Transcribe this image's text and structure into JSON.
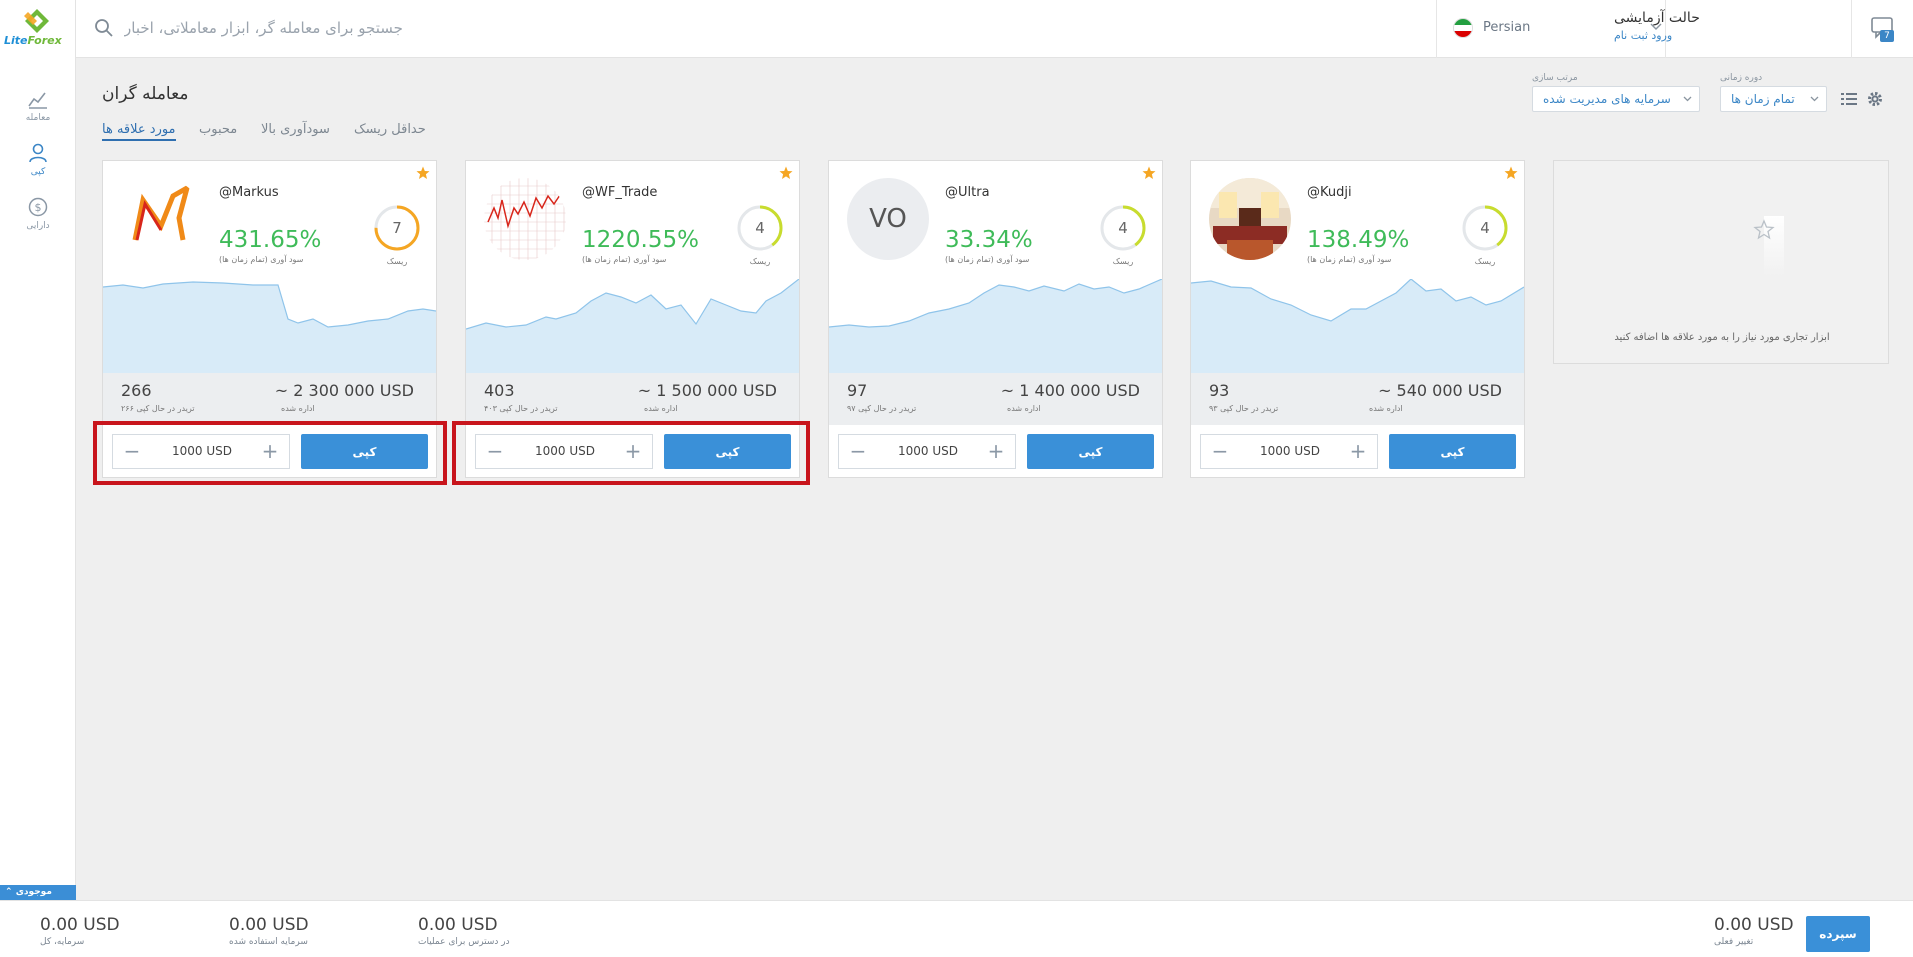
{
  "brand": {
    "name_part1": "Lite",
    "name_part2": "Forex"
  },
  "rail": {
    "items": [
      {
        "label": "معامله",
        "icon": "chart-icon"
      },
      {
        "label": "کپی",
        "icon": "user-icon"
      },
      {
        "label": "دارایی",
        "icon": "dollar-icon"
      }
    ],
    "balance_label": "موجودی"
  },
  "topbar": {
    "search_placeholder": "جستجو برای معامله گر، ابزار معاملاتی، اخبار",
    "language": "Persian",
    "mode_title": "حالت آزمایشی",
    "mode_link": "ورود ثبت نام",
    "chat_badge": "7"
  },
  "header": {
    "title": "معامله گران",
    "tabs": [
      "مورد علاقه ها",
      "محبوب",
      "سودآوری بالا",
      "حداقل ریسک"
    ],
    "active_tab": "مورد علاقه ها",
    "sort_label": "مرتب سازی",
    "sort_value": "سرمایه های مدیریت شده",
    "period_label": "دوره زمانی",
    "period_value": "تمام زمان ها"
  },
  "card_labels": {
    "profit_label": "سود آوری (تمام زمان ها)",
    "risk_label": "ریسک",
    "managed_label": "اداره شده",
    "copy_button": "کپی"
  },
  "traders": [
    {
      "handle": "@Markus",
      "profit": "431.65%",
      "risk": "7",
      "risk_level": 0.75,
      "risk_color": "#f5a623",
      "count": "266",
      "count_label": "تریدر در حال کپی ۲۶۶",
      "managed": "~ 2 300 000 USD",
      "amount": "1000 USD",
      "avatar": "markus-logo"
    },
    {
      "handle": "@WF_Trade",
      "profit": "1220.55%",
      "risk": "4",
      "risk_level": 0.4,
      "risk_color": "#c8dc2e",
      "count": "403",
      "count_label": "تریدر در حال کپی ۴۰۳",
      "managed": "~ 1 500 000 USD",
      "amount": "1000 USD",
      "avatar": "chart-thumbnail"
    },
    {
      "handle": "@Ultra",
      "profit": "33.34%",
      "risk": "4",
      "risk_level": 0.4,
      "risk_color": "#c8dc2e",
      "count": "97",
      "count_label": "تریدر در حال کپی ۹۷",
      "managed": "~ 1 400 000 USD",
      "amount": "1000 USD",
      "avatar": "VO"
    },
    {
      "handle": "@Kudji",
      "profit": "138.49%",
      "risk": "4",
      "risk_level": 0.4,
      "risk_color": "#c8dc2e",
      "count": "93",
      "count_label": "تریدر در حال کپی ۹۳",
      "managed": "~ 540 000 USD",
      "amount": "1000 USD",
      "avatar": "room-photo"
    }
  ],
  "empty_card": {
    "text": "ابزار تجاری مورد نیاز را به مورد علاقه ها اضافه کنید"
  },
  "bottombar": {
    "total": {
      "value": "0.00 USD",
      "label": "سرمایه، کل"
    },
    "used": {
      "value": "0.00 USD",
      "label": "سرمایه استفاده شده"
    },
    "available": {
      "value": "0.00 USD",
      "label": "در دسترس برای عملیات"
    },
    "change": {
      "value": "0.00 USD",
      "label": "تغییر فعلی"
    },
    "deposit_button": "سپرده"
  },
  "colors": {
    "accent": "#3a90d8",
    "profit": "#3fbb59",
    "highlight": "#c8151c"
  }
}
